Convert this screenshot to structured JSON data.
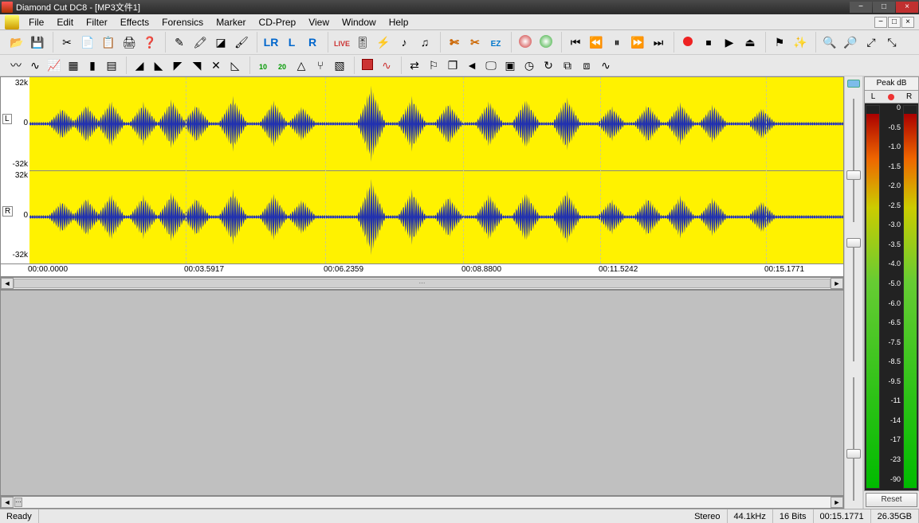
{
  "titlebar": {
    "title": "Diamond Cut DC8 - [MP3文件1]"
  },
  "menu": [
    "File",
    "Edit",
    "Filter",
    "Effects",
    "Forensics",
    "Marker",
    "CD-Prep",
    "View",
    "Window",
    "Help"
  ],
  "toolbar_row1": [
    [
      "open",
      "save"
    ],
    [
      "cut",
      "copy",
      "paste",
      "print",
      "help"
    ],
    [
      "pencil",
      "marker",
      "eraser",
      "brush"
    ],
    [
      "lr-button",
      "l-button",
      "r-button"
    ],
    [
      "live",
      "equalizer",
      "flash",
      "note",
      "note2"
    ],
    [
      "fx1",
      "fx2",
      "ez"
    ],
    [
      "cd",
      "dvd"
    ],
    [
      "skip-start",
      "rewind",
      "pause",
      "fforward",
      "skip-end"
    ],
    [
      "record",
      "stop",
      "play",
      "eject"
    ],
    [
      "flag",
      "sparkle"
    ],
    [
      "zoom-in",
      "zoom-out",
      "zoom-full",
      "zoom-sel"
    ]
  ],
  "toolbar_row2": [
    [
      "wave1",
      "wave2",
      "spectrum",
      "grid",
      "bars",
      "histogram"
    ],
    [
      "env1",
      "env2",
      "env3",
      "env4",
      "cross",
      "triangle"
    ],
    [
      "n10",
      "n20",
      "peak",
      "fork",
      "color"
    ],
    [
      "red-box",
      "red-wave"
    ],
    [
      "arrows",
      "flag2",
      "layers",
      "back",
      "monitor",
      "monitor2",
      "clock",
      "loop",
      "clip",
      "clip2",
      "sine"
    ]
  ],
  "y_axis": {
    "top": "32k",
    "mid": "0",
    "bot": "-32k",
    "l_mark": "L",
    "r_mark": "R"
  },
  "time_ticks": [
    "00:00.0000",
    "00:03.5917",
    "00:06.2359",
    "00:08.8800",
    "00:11.5242",
    "00:15.1771"
  ],
  "peak": {
    "title": "Peak dB",
    "left": "L",
    "right": "R",
    "labels": [
      "0",
      "-0.5",
      "-1.0",
      "-1.5",
      "-2.0",
      "-2.5",
      "-3.0",
      "-3.5",
      "-4.0",
      "-5.0",
      "-6.0",
      "-6.5",
      "-7.5",
      "-8.5",
      "-9.5",
      "-11",
      "-14",
      "-17",
      "-23",
      "-90"
    ],
    "reset": "Reset"
  },
  "status": {
    "ready": "Ready",
    "stereo": "Stereo",
    "rate": "44.1kHz",
    "bits": "16 Bits",
    "time": "00:15.1771",
    "disk": "26.35GB"
  }
}
